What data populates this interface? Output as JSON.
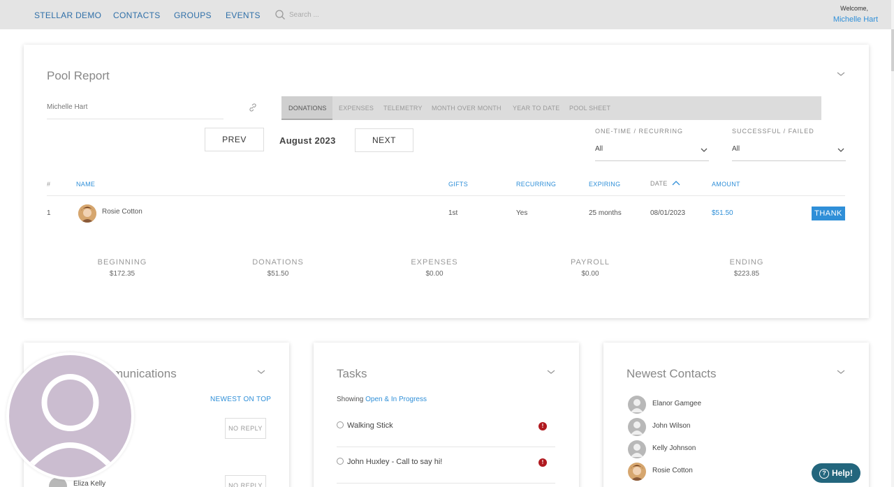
{
  "nav": {
    "brand": "STELLAR DEMO",
    "items": [
      "CONTACTS",
      "GROUPS",
      "EVENTS"
    ],
    "search_placeholder": "Search ...",
    "welcome": "Welcome,",
    "user": "Michelle Hart"
  },
  "pool": {
    "title": "Pool Report",
    "user": "Michelle Hart",
    "tabs": [
      "DONATIONS",
      "EXPENSES",
      "TELEMETRY",
      "MONTH OVER MONTH",
      "YEAR TO DATE",
      "POOL SHEET"
    ],
    "active_tab": "DONATIONS",
    "prev_label": "PREV",
    "next_label": "NEXT",
    "month": "August 2023",
    "filter1_label": "ONE-TIME / RECURRING",
    "filter1_value": "All",
    "filter2_label": "SUCCESSFUL / FAILED",
    "filter2_value": "All",
    "columns": [
      "#",
      "NAME",
      "GIFTS",
      "RECURRING",
      "EXPIRING",
      "DATE",
      "AMOUNT"
    ],
    "rows": [
      {
        "num": "1",
        "name": "Rosie Cotton",
        "gifts": "1st",
        "recurring": "Yes",
        "expiring": "25 months",
        "date": "08/01/2023",
        "amount": "$51.50",
        "action": "THANK"
      }
    ],
    "summary": [
      {
        "label": "BEGINNING",
        "value": "$172.35"
      },
      {
        "label": "DONATIONS",
        "value": "$51.50"
      },
      {
        "label": "EXPENSES",
        "value": "$0.00"
      },
      {
        "label": "PAYROLL",
        "value": "$0.00"
      },
      {
        "label": "ENDING",
        "value": "$223.85"
      }
    ]
  },
  "communications": {
    "title": "munications",
    "sort_label": "NEWEST ON TOP",
    "no_reply": "NO REPLY",
    "visible_contact": "Eliza Kelly"
  },
  "tasks": {
    "title": "Tasks",
    "showing_prefix": "Showing",
    "showing_filter": "Open & In Progress",
    "items": [
      "Walking Stick",
      "John Huxley - Call to say hi!"
    ]
  },
  "contacts": {
    "title": "Newest Contacts",
    "items": [
      "Elanor Gamgee",
      "John Wilson",
      "Kelly Johnson",
      "Rosie Cotton"
    ]
  },
  "help": {
    "label": "Help!"
  },
  "colors": {
    "accent": "#2f8fd8",
    "nav_bg": "#e4e4e4",
    "help_bg": "#23667d",
    "alert": "#b0191f"
  }
}
